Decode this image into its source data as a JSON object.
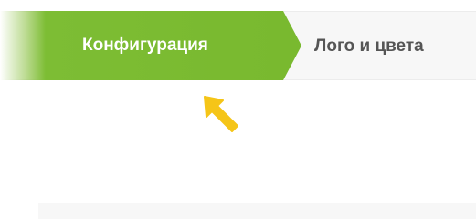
{
  "wizard": {
    "steps": [
      {
        "label": "Конфигурация",
        "state": "active"
      },
      {
        "label": "Лого и цвета",
        "state": "inactive"
      }
    ]
  },
  "colors": {
    "accent_green": "#79b92f",
    "pointer_yellow": "#f5c518",
    "inactive_text": "#555555"
  },
  "icons": {
    "pointer": "arrow-pointer-icon"
  }
}
